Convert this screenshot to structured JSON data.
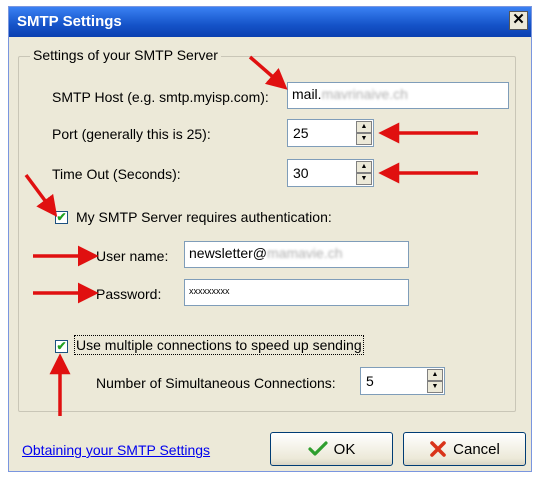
{
  "window": {
    "title": "SMTP Settings",
    "close_glyph": "✕"
  },
  "group": {
    "legend": "Settings of your SMTP Server"
  },
  "host": {
    "label": "SMTP Host (e.g. smtp.myisp.com):",
    "value_prefix": "mail.",
    "value_obscured": "mavrinaive.ch"
  },
  "port": {
    "label": "Port (generally this is 25):",
    "value": "25"
  },
  "timeout": {
    "label": "Time Out (Seconds):",
    "value": "30"
  },
  "auth": {
    "label": "My SMTP Server requires authentication:",
    "checked": true
  },
  "user": {
    "label": "User name:",
    "value_prefix": "newsletter@",
    "value_obscured": "mamavie.ch"
  },
  "password": {
    "label": "Password:",
    "value": "xxxxxxxxx"
  },
  "multi": {
    "label": "Use multiple connections to speed up sending",
    "checked": true
  },
  "connections": {
    "label": "Number of Simultaneous Connections:",
    "value": "5"
  },
  "footer": {
    "link": "Obtaining your SMTP Settings",
    "ok_label": "OK",
    "cancel_label": "Cancel"
  },
  "spinner": {
    "up_glyph": "▲",
    "down_glyph": "▼"
  },
  "checkbox_glyph": "✔",
  "colors": {
    "title_bar": "#1553c8",
    "dialog_bg": "#ece9d8",
    "annotation_arrows": "#e01010",
    "link": "#0000ee"
  }
}
